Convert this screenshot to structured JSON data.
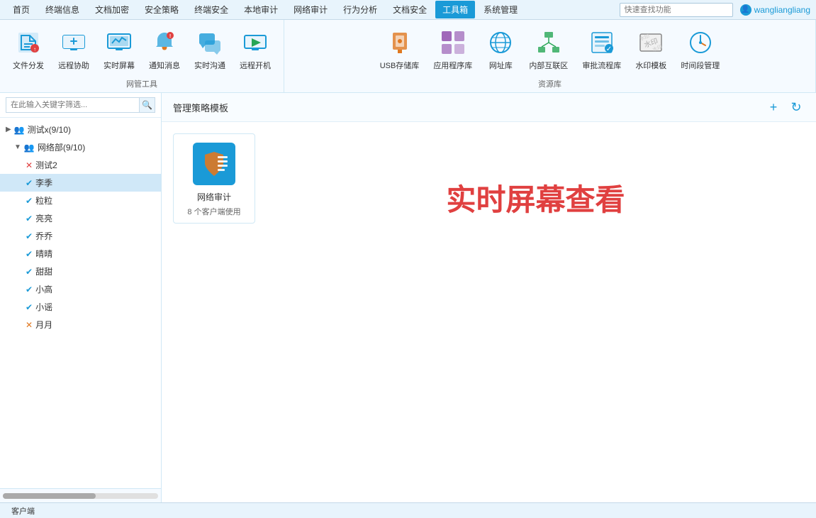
{
  "topnav": {
    "items": [
      {
        "label": "首页",
        "active": false
      },
      {
        "label": "终端信息",
        "active": false
      },
      {
        "label": "文档加密",
        "active": false
      },
      {
        "label": "安全策略",
        "active": false
      },
      {
        "label": "终端安全",
        "active": false
      },
      {
        "label": "本地审计",
        "active": false
      },
      {
        "label": "网络审计",
        "active": false
      },
      {
        "label": "行为分析",
        "active": false
      },
      {
        "label": "文档安全",
        "active": false
      },
      {
        "label": "工具箱",
        "active": true
      },
      {
        "label": "系统管理",
        "active": false
      }
    ],
    "search_placeholder": "快速查找功能",
    "username": "wangliangliang"
  },
  "toolbar": {
    "sections": [
      {
        "label": "网管工具",
        "items": [
          {
            "label": "文件分发"
          },
          {
            "label": "远程协助"
          },
          {
            "label": "实时屏幕"
          },
          {
            "label": "通知消息"
          },
          {
            "label": "实时沟通"
          },
          {
            "label": "远程开机"
          }
        ]
      },
      {
        "label": "资源库",
        "items": [
          {
            "label": "USB存储库"
          },
          {
            "label": "应用程序库"
          },
          {
            "label": "网址库"
          },
          {
            "label": "内部互联区"
          },
          {
            "label": "审批流程库"
          },
          {
            "label": "水印模板"
          },
          {
            "label": "时间段管理"
          }
        ]
      }
    ]
  },
  "sidebar": {
    "search_placeholder": "在此输入关键字筛选...",
    "tree": {
      "root_label": "测试x(9/10)",
      "group_label": "网络部(9/10)",
      "leaves": [
        {
          "label": "测试2",
          "status": "err"
        },
        {
          "label": "李季",
          "status": "ok"
        },
        {
          "label": "粒粒",
          "status": "ok"
        },
        {
          "label": "亮亮",
          "status": "ok"
        },
        {
          "label": "乔乔",
          "status": "ok"
        },
        {
          "label": "晴晴",
          "status": "ok"
        },
        {
          "label": "甜甜",
          "status": "ok"
        },
        {
          "label": "小高",
          "status": "ok"
        },
        {
          "label": "小谣",
          "status": "ok"
        },
        {
          "label": "月月",
          "status": "warn"
        }
      ]
    },
    "bottom_tab": "客户端"
  },
  "content": {
    "title": "管理策略模板",
    "add_btn": "+",
    "refresh_btn": "↻",
    "policy_card": {
      "name": "网络审计",
      "count": "8 个客户端使用"
    },
    "realtime_text": "实时屏幕查看"
  }
}
